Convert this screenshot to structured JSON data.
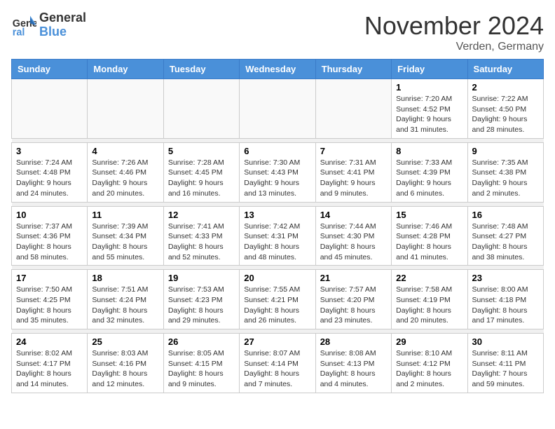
{
  "logo": {
    "general": "General",
    "blue": "Blue"
  },
  "title": "November 2024",
  "location": "Verden, Germany",
  "days_header": [
    "Sunday",
    "Monday",
    "Tuesday",
    "Wednesday",
    "Thursday",
    "Friday",
    "Saturday"
  ],
  "weeks": [
    [
      {
        "day": "",
        "info": ""
      },
      {
        "day": "",
        "info": ""
      },
      {
        "day": "",
        "info": ""
      },
      {
        "day": "",
        "info": ""
      },
      {
        "day": "",
        "info": ""
      },
      {
        "day": "1",
        "info": "Sunrise: 7:20 AM\nSunset: 4:52 PM\nDaylight: 9 hours and 31 minutes."
      },
      {
        "day": "2",
        "info": "Sunrise: 7:22 AM\nSunset: 4:50 PM\nDaylight: 9 hours and 28 minutes."
      }
    ],
    [
      {
        "day": "3",
        "info": "Sunrise: 7:24 AM\nSunset: 4:48 PM\nDaylight: 9 hours and 24 minutes."
      },
      {
        "day": "4",
        "info": "Sunrise: 7:26 AM\nSunset: 4:46 PM\nDaylight: 9 hours and 20 minutes."
      },
      {
        "day": "5",
        "info": "Sunrise: 7:28 AM\nSunset: 4:45 PM\nDaylight: 9 hours and 16 minutes."
      },
      {
        "day": "6",
        "info": "Sunrise: 7:30 AM\nSunset: 4:43 PM\nDaylight: 9 hours and 13 minutes."
      },
      {
        "day": "7",
        "info": "Sunrise: 7:31 AM\nSunset: 4:41 PM\nDaylight: 9 hours and 9 minutes."
      },
      {
        "day": "8",
        "info": "Sunrise: 7:33 AM\nSunset: 4:39 PM\nDaylight: 9 hours and 6 minutes."
      },
      {
        "day": "9",
        "info": "Sunrise: 7:35 AM\nSunset: 4:38 PM\nDaylight: 9 hours and 2 minutes."
      }
    ],
    [
      {
        "day": "10",
        "info": "Sunrise: 7:37 AM\nSunset: 4:36 PM\nDaylight: 8 hours and 58 minutes."
      },
      {
        "day": "11",
        "info": "Sunrise: 7:39 AM\nSunset: 4:34 PM\nDaylight: 8 hours and 55 minutes."
      },
      {
        "day": "12",
        "info": "Sunrise: 7:41 AM\nSunset: 4:33 PM\nDaylight: 8 hours and 52 minutes."
      },
      {
        "day": "13",
        "info": "Sunrise: 7:42 AM\nSunset: 4:31 PM\nDaylight: 8 hours and 48 minutes."
      },
      {
        "day": "14",
        "info": "Sunrise: 7:44 AM\nSunset: 4:30 PM\nDaylight: 8 hours and 45 minutes."
      },
      {
        "day": "15",
        "info": "Sunrise: 7:46 AM\nSunset: 4:28 PM\nDaylight: 8 hours and 41 minutes."
      },
      {
        "day": "16",
        "info": "Sunrise: 7:48 AM\nSunset: 4:27 PM\nDaylight: 8 hours and 38 minutes."
      }
    ],
    [
      {
        "day": "17",
        "info": "Sunrise: 7:50 AM\nSunset: 4:25 PM\nDaylight: 8 hours and 35 minutes."
      },
      {
        "day": "18",
        "info": "Sunrise: 7:51 AM\nSunset: 4:24 PM\nDaylight: 8 hours and 32 minutes."
      },
      {
        "day": "19",
        "info": "Sunrise: 7:53 AM\nSunset: 4:23 PM\nDaylight: 8 hours and 29 minutes."
      },
      {
        "day": "20",
        "info": "Sunrise: 7:55 AM\nSunset: 4:21 PM\nDaylight: 8 hours and 26 minutes."
      },
      {
        "day": "21",
        "info": "Sunrise: 7:57 AM\nSunset: 4:20 PM\nDaylight: 8 hours and 23 minutes."
      },
      {
        "day": "22",
        "info": "Sunrise: 7:58 AM\nSunset: 4:19 PM\nDaylight: 8 hours and 20 minutes."
      },
      {
        "day": "23",
        "info": "Sunrise: 8:00 AM\nSunset: 4:18 PM\nDaylight: 8 hours and 17 minutes."
      }
    ],
    [
      {
        "day": "24",
        "info": "Sunrise: 8:02 AM\nSunset: 4:17 PM\nDaylight: 8 hours and 14 minutes."
      },
      {
        "day": "25",
        "info": "Sunrise: 8:03 AM\nSunset: 4:16 PM\nDaylight: 8 hours and 12 minutes."
      },
      {
        "day": "26",
        "info": "Sunrise: 8:05 AM\nSunset: 4:15 PM\nDaylight: 8 hours and 9 minutes."
      },
      {
        "day": "27",
        "info": "Sunrise: 8:07 AM\nSunset: 4:14 PM\nDaylight: 8 hours and 7 minutes."
      },
      {
        "day": "28",
        "info": "Sunrise: 8:08 AM\nSunset: 4:13 PM\nDaylight: 8 hours and 4 minutes."
      },
      {
        "day": "29",
        "info": "Sunrise: 8:10 AM\nSunset: 4:12 PM\nDaylight: 8 hours and 2 minutes."
      },
      {
        "day": "30",
        "info": "Sunrise: 8:11 AM\nSunset: 4:11 PM\nDaylight: 7 hours and 59 minutes."
      }
    ]
  ]
}
